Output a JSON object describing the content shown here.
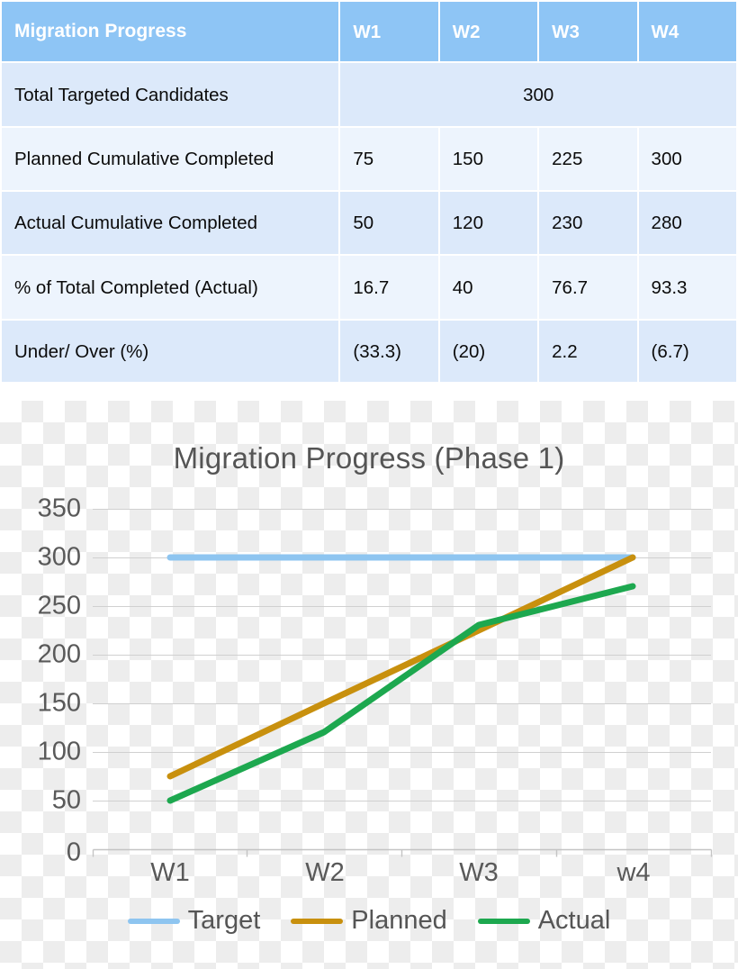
{
  "table": {
    "header": {
      "title": "Migration Progress",
      "weeks": [
        "W1",
        "W2",
        "W3",
        "W4"
      ]
    },
    "rows": [
      {
        "label": "Total Targeted Candidates",
        "merged": true,
        "merged_value": "300"
      },
      {
        "label": "Planned Cumulative Completed",
        "values": [
          "75",
          "150",
          "225",
          "300"
        ]
      },
      {
        "label": "Actual Cumulative Completed",
        "values": [
          "50",
          "120",
          "230",
          "280"
        ]
      },
      {
        "label": "% of Total Completed (Actual)",
        "values": [
          "16.7",
          "40",
          "76.7",
          "93.3"
        ]
      },
      {
        "label": "Under/ Over (%)",
        "values": [
          "(33.3)",
          "(20)",
          "2.2",
          "(6.7)"
        ],
        "negative": [
          true,
          true,
          false,
          true
        ]
      }
    ]
  },
  "chart_data": {
    "type": "line",
    "title": "Migration Progress (Phase 1)",
    "xlabel": "",
    "ylabel": "",
    "categories": [
      "W1",
      "W2",
      "W3",
      "w4"
    ],
    "ylim": [
      0,
      350
    ],
    "yticks": [
      0,
      50,
      100,
      150,
      200,
      250,
      300,
      350
    ],
    "grid": true,
    "legend_position": "bottom",
    "series": [
      {
        "name": "Target",
        "color": "#8ec5f0",
        "values": [
          300,
          300,
          300,
          300
        ]
      },
      {
        "name": "Planned",
        "color": "#c8900e",
        "values": [
          75,
          150,
          225,
          300
        ]
      },
      {
        "name": "Actual",
        "color": "#1da84f",
        "values": [
          50,
          120,
          230,
          280
        ]
      }
    ]
  },
  "colors": {
    "table_header_bg": "#8ec5f5",
    "table_band_a": "#dce9fa",
    "table_band_b": "#edf4fd",
    "negative_text": "#ff0000",
    "chart_text": "#555555"
  }
}
